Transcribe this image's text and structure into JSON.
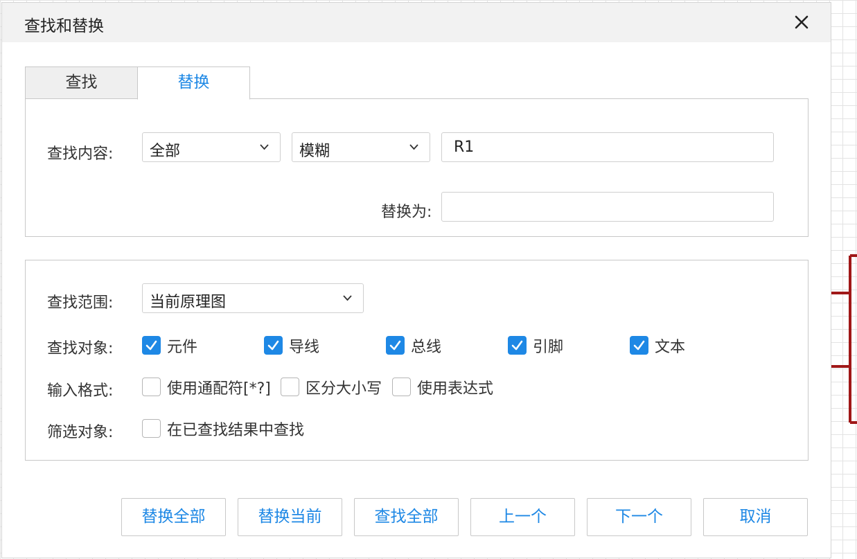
{
  "dialog": {
    "title": "查找和替换"
  },
  "tabs": [
    {
      "label": "查找"
    },
    {
      "label": "替换"
    }
  ],
  "search": {
    "label": "查找内容:",
    "scope_select": "全部",
    "mode_select": "模糊",
    "value": "R1",
    "replace_label": "替换为:",
    "replace_value": ""
  },
  "range": {
    "label": "查找范围:",
    "value": "当前原理图"
  },
  "objects": {
    "label": "查找对象:",
    "items": [
      {
        "label": "元件",
        "checked": true
      },
      {
        "label": "导线",
        "checked": true
      },
      {
        "label": "总线",
        "checked": true
      },
      {
        "label": "引脚",
        "checked": true
      },
      {
        "label": "文本",
        "checked": true
      }
    ]
  },
  "format": {
    "label": "输入格式:",
    "items": [
      {
        "label": "使用通配符[*?]",
        "checked": false
      },
      {
        "label": "区分大小写",
        "checked": false
      },
      {
        "label": "使用表达式",
        "checked": false
      }
    ]
  },
  "filter": {
    "label": "筛选对象:",
    "items": [
      {
        "label": "在已查找结果中查找",
        "checked": false
      }
    ]
  },
  "buttons": {
    "replace_all": "替换全部",
    "replace_current": "替换当前",
    "find_all": "查找全部",
    "prev": "上一个",
    "next": "下一个",
    "cancel": "取消"
  },
  "colors": {
    "accent": "#1e88e5",
    "schematic_wire": "#a01818"
  }
}
